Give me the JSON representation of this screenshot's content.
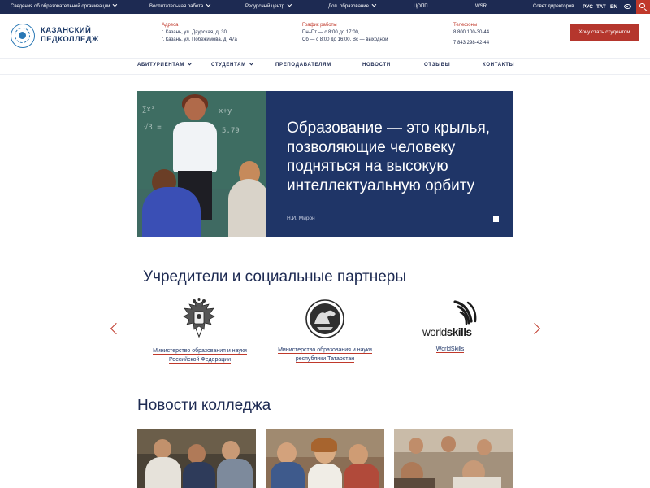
{
  "topbar": {
    "links": [
      {
        "label": "Сведения об образовательной организации",
        "has_dropdown": true
      },
      {
        "label": "Воспитательная работа",
        "has_dropdown": true
      },
      {
        "label": "Ресурсный центр",
        "has_dropdown": true
      },
      {
        "label": "Доп. образование",
        "has_dropdown": true
      },
      {
        "label": "ЦОПП",
        "has_dropdown": false
      },
      {
        "label": "WSR",
        "has_dropdown": false
      },
      {
        "label": "Совет директоров",
        "has_dropdown": false
      }
    ],
    "languages": [
      "РУС",
      "TAT",
      "EN"
    ],
    "icons": [
      "eye-icon",
      "search-icon"
    ]
  },
  "header": {
    "logo_line1": "КАЗАНСКИЙ",
    "logo_line2": "ПЕДКОЛЛЕДЖ",
    "address_label": "Адреса",
    "address_lines": [
      "г. Казань, ул. Даурская, д. 30,",
      "г. Казань, ул. Побежимова, д. 47а"
    ],
    "schedule_label": "График работы",
    "schedule_lines": [
      "Пн–Пт — с 8:00 до 17:00,",
      "Сб — с 8:00 до 16:00, Вс — выходной"
    ],
    "phone_label": "Телефоны",
    "phone_lines": [
      "8 800 100-30-44",
      "7 843 298-42-44"
    ],
    "cta_label": "Хочу стать студентом"
  },
  "nav": {
    "items": [
      {
        "label": "АБИТУРИЕНТАМ",
        "has_dropdown": true
      },
      {
        "label": "СТУДЕНТАМ",
        "has_dropdown": true
      },
      {
        "label": "ПРЕПОДАВАТЕЛЯМ",
        "has_dropdown": false
      },
      {
        "label": "НОВОСТИ",
        "has_dropdown": false
      },
      {
        "label": "ОТЗЫВЫ",
        "has_dropdown": false
      },
      {
        "label": "КОНТАКТЫ",
        "has_dropdown": false
      }
    ]
  },
  "hero": {
    "quote_lines": [
      "Образование — это крылья,",
      "позволяющие человеку",
      "подняться на высокую",
      "интеллектуальную орбиту"
    ],
    "author": "Н.И. Мирон"
  },
  "partners": {
    "title": "Учредители и социальные партнеры",
    "items": [
      {
        "caption_lines": [
          "Министерство образования и науки",
          "Российской Федерации"
        ],
        "logo": "russia-coat-of-arms-icon"
      },
      {
        "caption_lines": [
          "Министерство образования и науки",
          "республики Татарстан"
        ],
        "logo": "tatarstan-emblem-icon"
      },
      {
        "caption_lines": [
          "WorldSkills"
        ],
        "logo": "worldskills-logo"
      }
    ],
    "worldskills_wordmark": {
      "part1": "world",
      "part2": "skills"
    }
  },
  "news": {
    "title": "Новости колледжа"
  },
  "colors": {
    "navy": "#1d2a52",
    "hero_panel": "#1f3567",
    "accent_red": "#b5362d"
  }
}
